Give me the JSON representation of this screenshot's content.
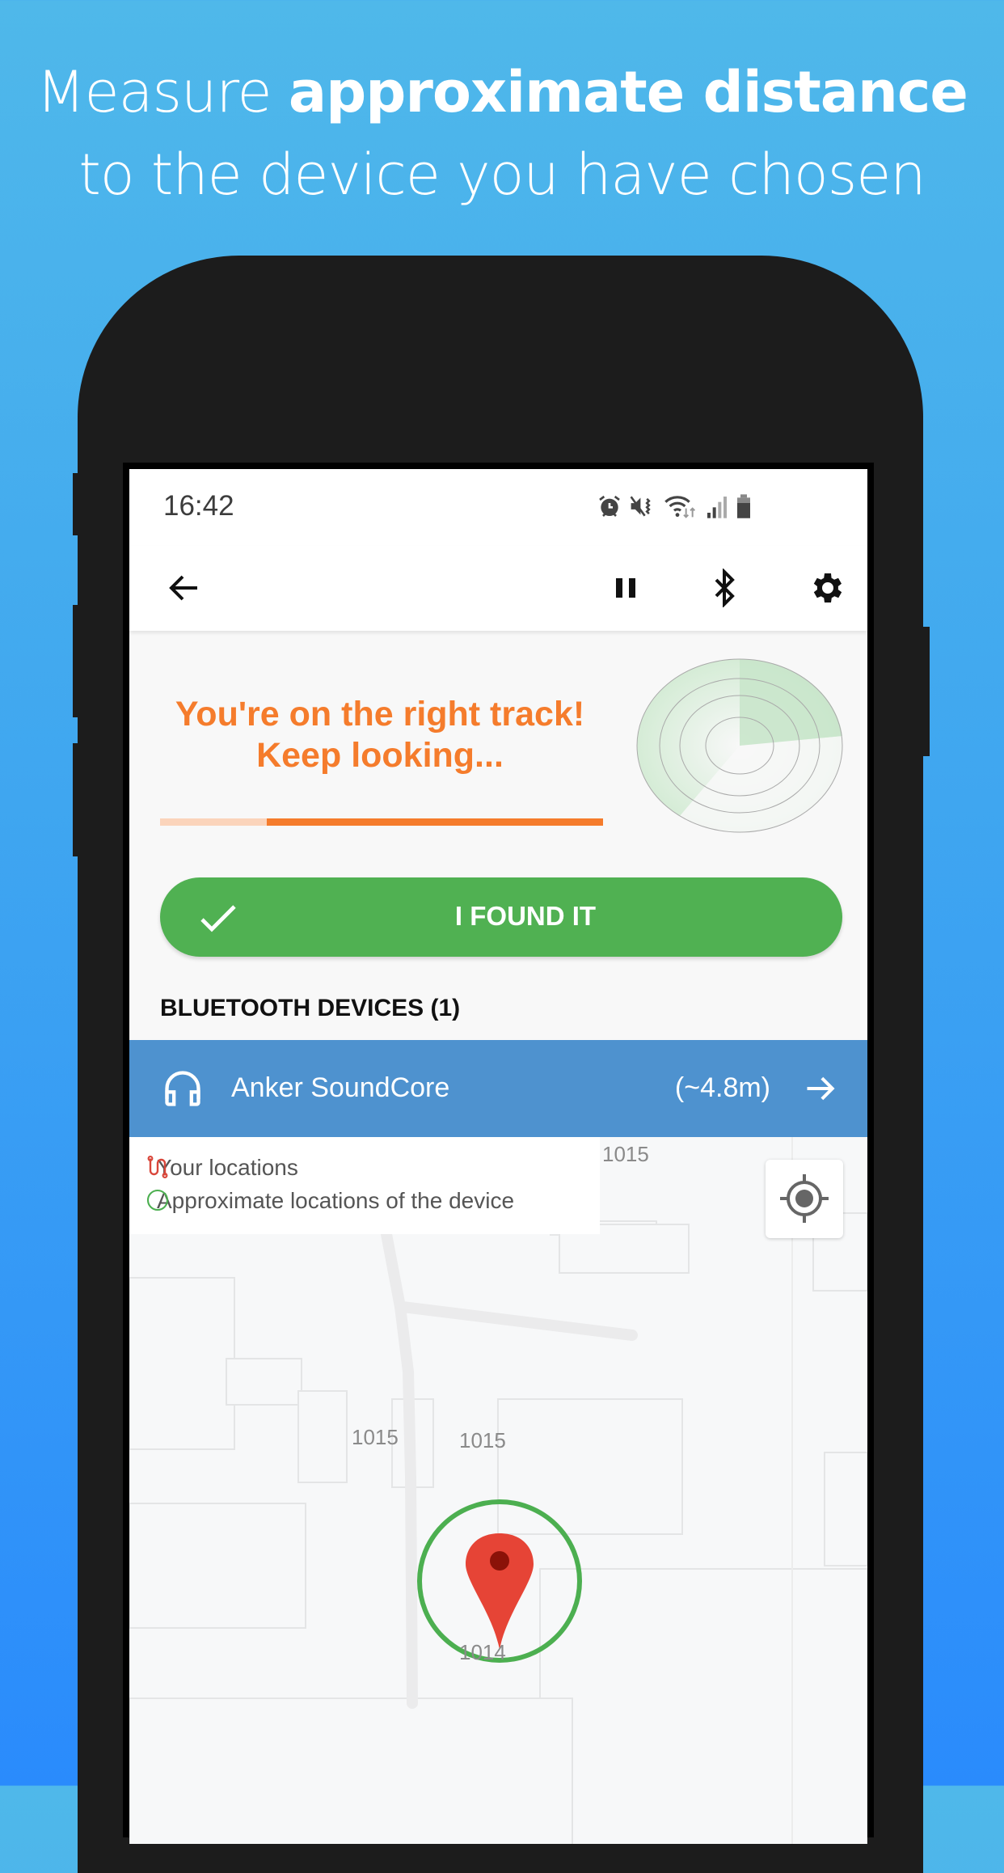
{
  "headline": {
    "line1_prefix": "Measure ",
    "line1_bold": "approximate distance",
    "line2": "to the device you have chosen"
  },
  "status_bar": {
    "time": "16:42",
    "icons": [
      "alarm-icon",
      "vibrate-mute-icon",
      "wifi-icon",
      "signal-icon",
      "battery-icon"
    ]
  },
  "toolbar": {
    "icons": [
      "back-arrow-icon",
      "pause-icon",
      "bluetooth-icon",
      "gear-icon"
    ]
  },
  "tracker": {
    "message": "You're on the right track! Keep looking...",
    "signal_strength": 0.76,
    "accent_color": "#f57c2c"
  },
  "found_button": {
    "label": "I FOUND IT",
    "icon": "checkmark-icon",
    "color": "#50b152"
  },
  "devices": {
    "header": "BLUETOOTH DEVICES (1)",
    "items": [
      {
        "name": "Anker SoundCore",
        "distance": "(~4.8m)",
        "icon": "headphones-icon",
        "color": "#4e92cf"
      }
    ]
  },
  "map": {
    "legend": [
      {
        "icon": "route-icon",
        "label": "Your locations"
      },
      {
        "icon": "circle-outline-icon",
        "label": "Approximate locations of the device"
      }
    ],
    "labels": [
      "1015",
      "1015",
      "1015",
      "1014"
    ],
    "locate_button_icon": "my-location-icon"
  }
}
